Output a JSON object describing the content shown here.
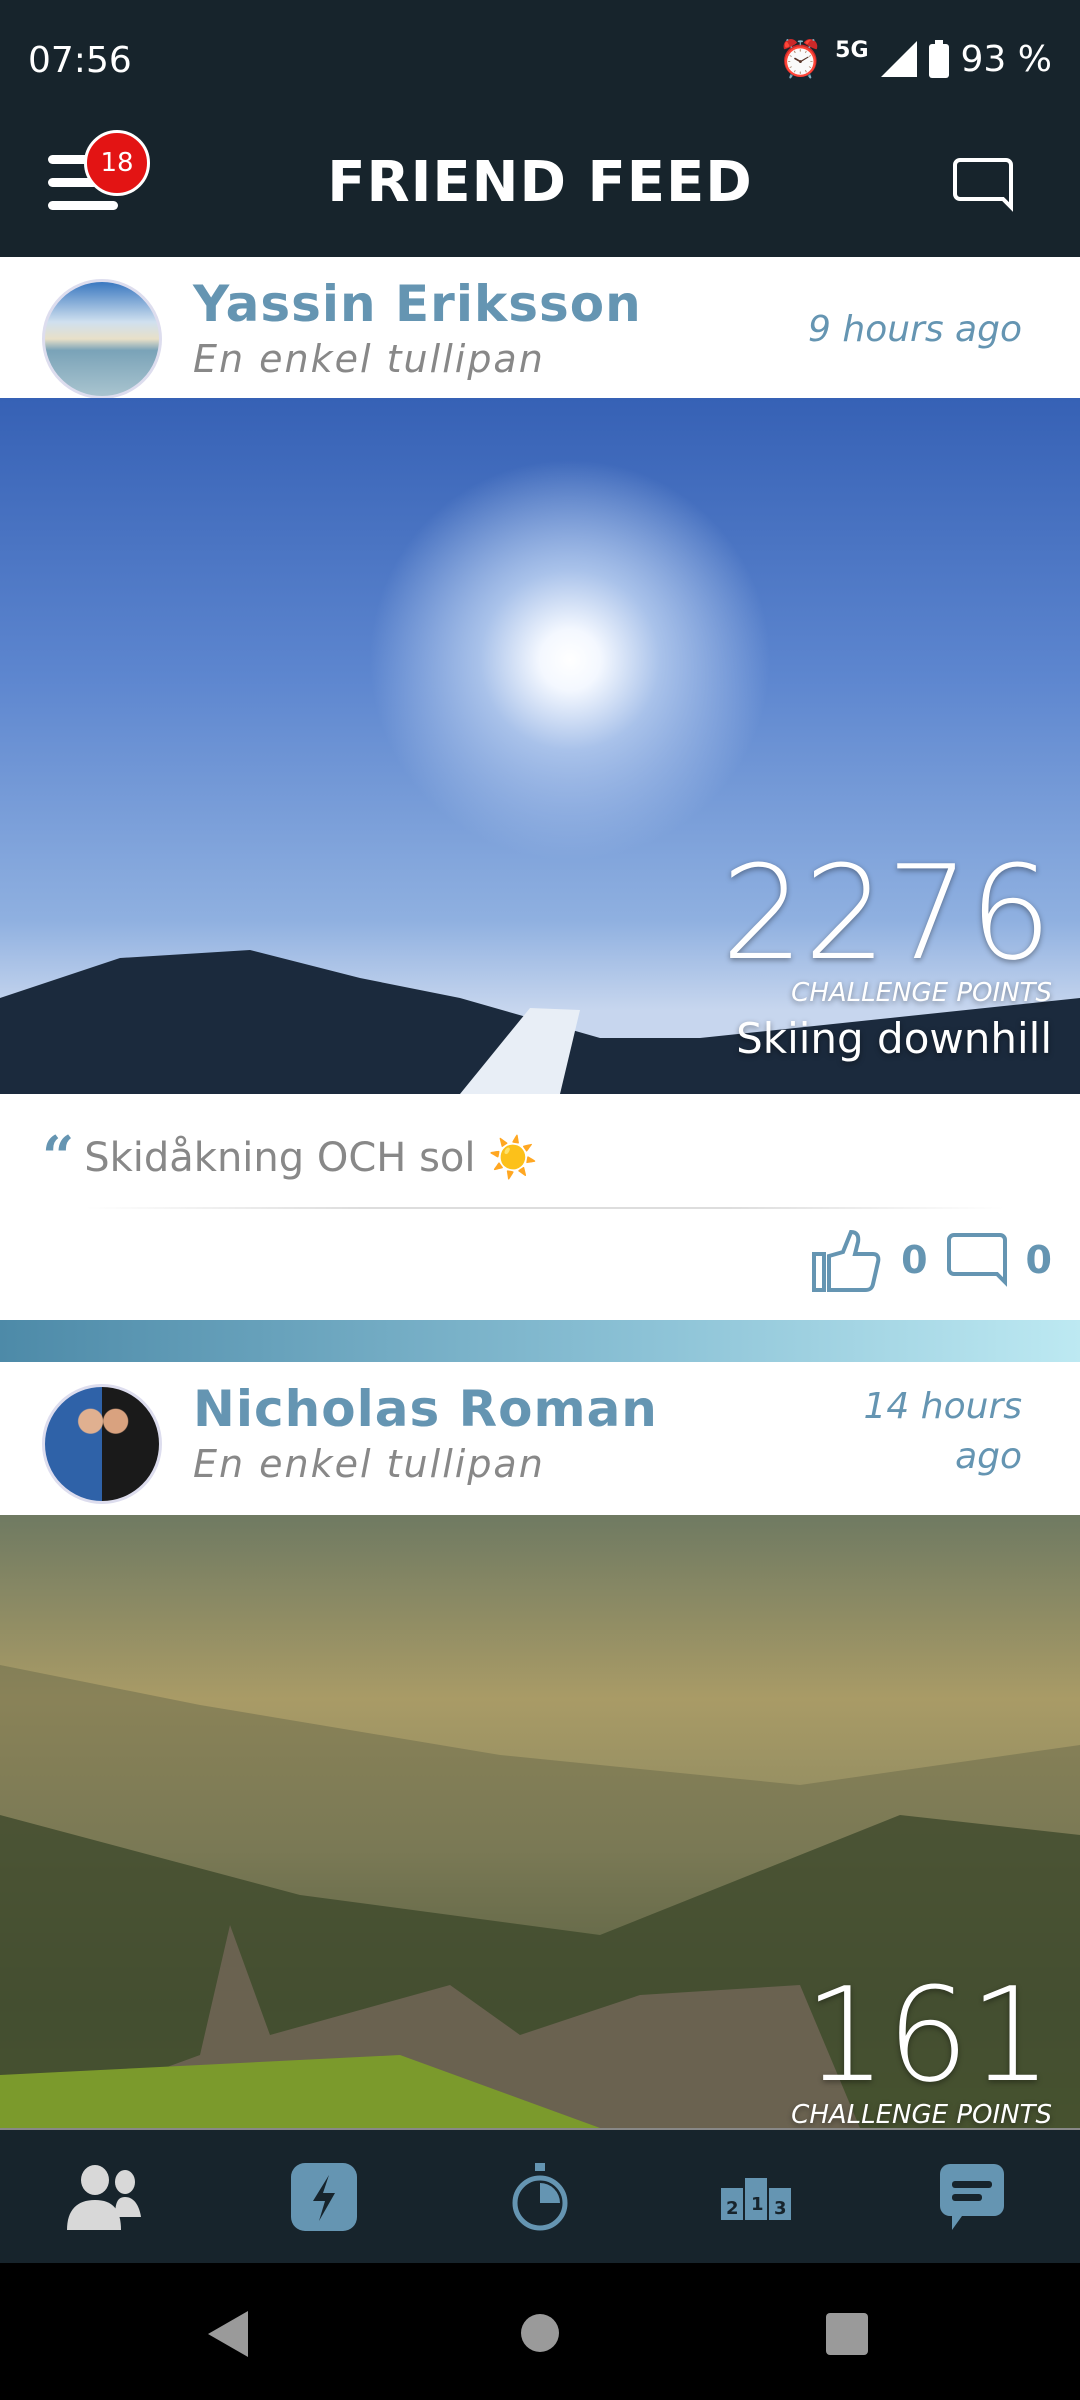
{
  "status_bar": {
    "time": "07:56",
    "network": "5G",
    "battery": "93 %"
  },
  "header": {
    "title": "FRIEND FEED",
    "notification_count": "18"
  },
  "posts": [
    {
      "name": "Yassin Eriksson",
      "subtitle": "En enkel tullipan",
      "time_ago": "9 hours ago",
      "points": "2276",
      "points_label": "CHALLENGE POINTS",
      "activity": "Skiing downhill",
      "caption": "Skidåkning OCH sol ☀️",
      "likes": "0",
      "comments": "0"
    },
    {
      "name": "Nicholas Roman",
      "subtitle": "En enkel tullipan",
      "time_ago": "14 hours ago",
      "points": "161",
      "points_label": "CHALLENGE POINTS"
    }
  ],
  "bottom_nav": [
    {
      "icon": "friends-icon"
    },
    {
      "icon": "lightning-icon",
      "active": true
    },
    {
      "icon": "stopwatch-icon"
    },
    {
      "icon": "podium-icon"
    },
    {
      "icon": "chat-bubble-icon"
    }
  ],
  "colors": {
    "header_bg": "#17242c",
    "accent": "#6595b2",
    "badge": "#e31414"
  }
}
